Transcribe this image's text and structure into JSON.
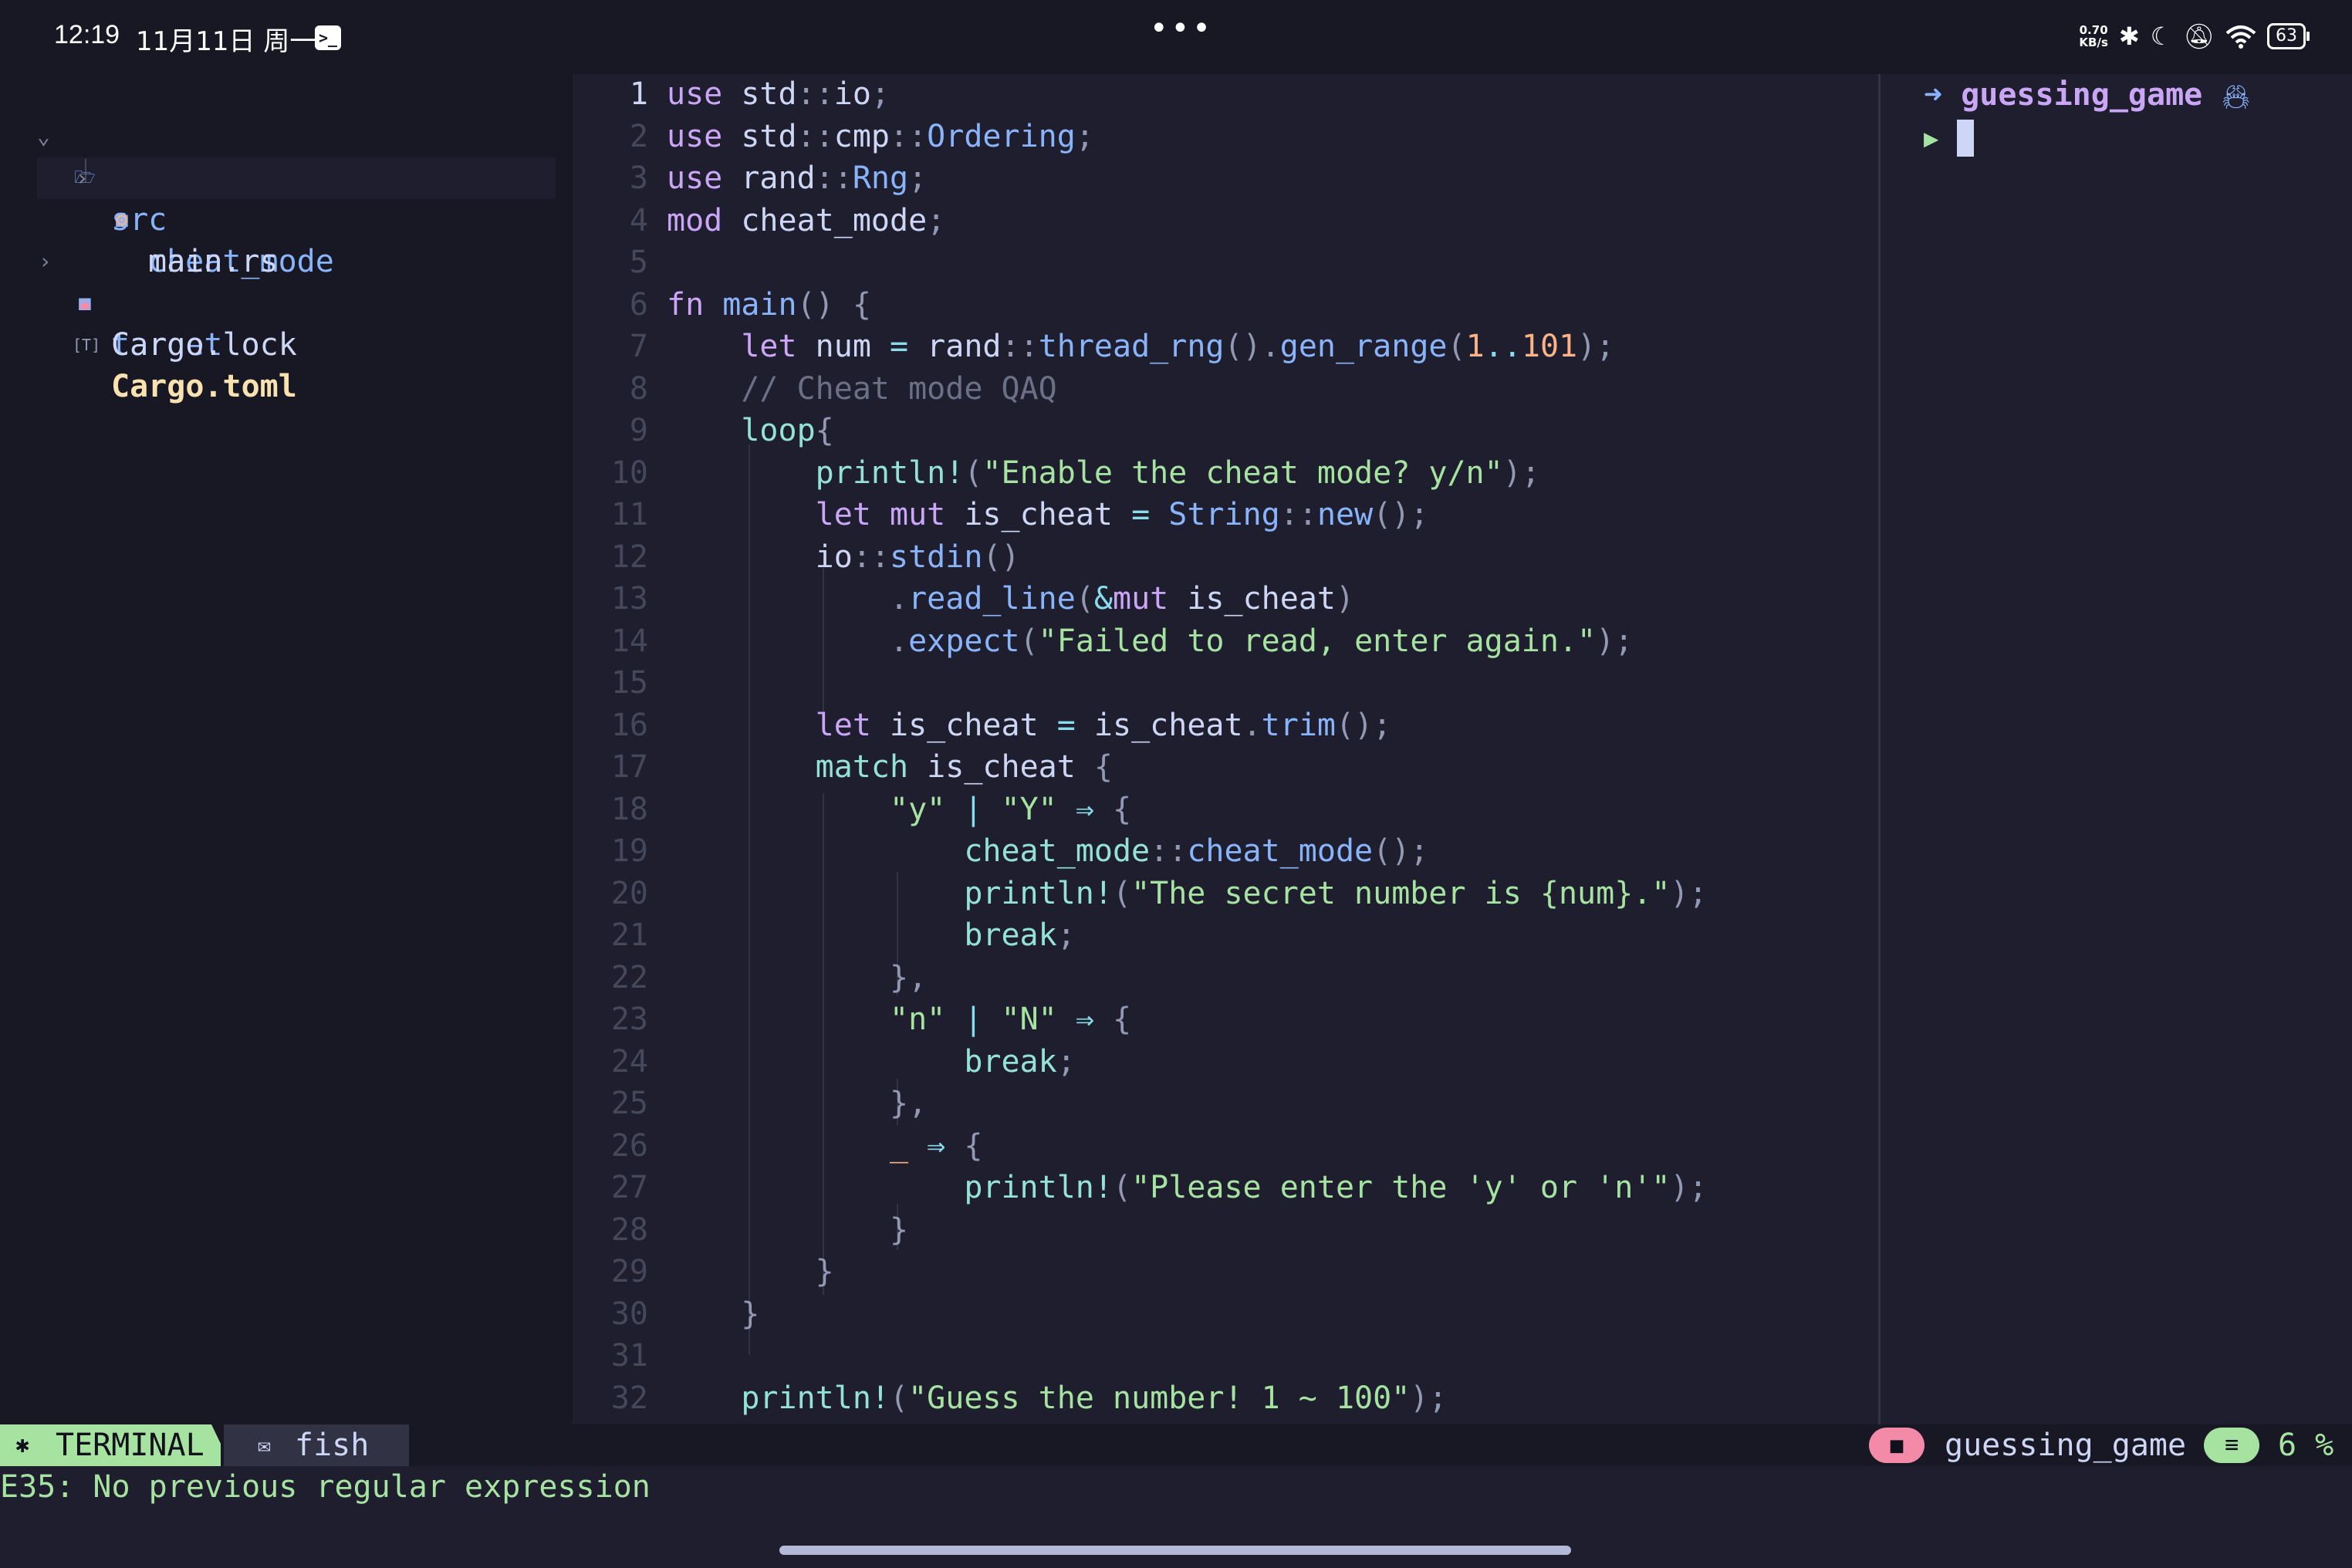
{
  "status_bar": {
    "time": "12:19",
    "date": "11月11日 周一",
    "app_icon": "terminal-icon",
    "menu_dots": "•••",
    "net_speed_value": "0.70",
    "net_speed_unit": "KB/s",
    "battery": "63",
    "icons": [
      "bluetooth-icon",
      "moon-icon",
      "bell-off-icon",
      "wifi-icon",
      "battery-icon"
    ]
  },
  "file_tree": {
    "items": [
      {
        "label": "src",
        "icon": "folder-open-icon",
        "expanded": true
      },
      {
        "label": "cheat_mode",
        "icon": "folder-icon",
        "expanded": false
      },
      {
        "label": "main.rs",
        "icon": "rust-icon",
        "selected": true
      },
      {
        "label": "target",
        "icon": "folder-icon",
        "expanded": false
      },
      {
        "label": "Cargo.lock",
        "icon": "lock-icon"
      },
      {
        "label": "Cargo.toml",
        "icon": "toml-icon",
        "modified": true
      }
    ]
  },
  "editor": {
    "current_line": 1,
    "lines": [
      [
        [
          "k",
          "use"
        ],
        [
          "tx",
          " std"
        ],
        [
          "p",
          "::"
        ],
        [
          "tx",
          "io"
        ],
        [
          "p",
          ";"
        ]
      ],
      [
        [
          "k",
          "use"
        ],
        [
          "tx",
          " std"
        ],
        [
          "p",
          "::"
        ],
        [
          "tx",
          "cmp"
        ],
        [
          "p",
          "::"
        ],
        [
          "f",
          "Ordering"
        ],
        [
          "p",
          ";"
        ]
      ],
      [
        [
          "k",
          "use"
        ],
        [
          "tx",
          " rand"
        ],
        [
          "p",
          "::"
        ],
        [
          "f",
          "Rng"
        ],
        [
          "p",
          ";"
        ]
      ],
      [
        [
          "k",
          "mod"
        ],
        [
          "tx",
          " cheat_mode"
        ],
        [
          "p",
          ";"
        ]
      ],
      [],
      [
        [
          "k",
          "fn"
        ],
        [
          "tx",
          " "
        ],
        [
          "f",
          "main"
        ],
        [
          "p",
          "() {"
        ]
      ],
      [
        [
          "tx",
          "    "
        ],
        [
          "k",
          "let"
        ],
        [
          "tx",
          " num "
        ],
        [
          "o",
          "="
        ],
        [
          "tx",
          " rand"
        ],
        [
          "p",
          "::"
        ],
        [
          "f",
          "thread_rng"
        ],
        [
          "p",
          "()."
        ],
        [
          "f",
          "gen_range"
        ],
        [
          "p",
          "("
        ],
        [
          "n",
          "1"
        ],
        [
          "o",
          ".."
        ],
        [
          "n",
          "101"
        ],
        [
          "p",
          ");"
        ]
      ],
      [
        [
          "c",
          "    // Cheat mode QAQ"
        ]
      ],
      [
        [
          "tx",
          "    "
        ],
        [
          "m",
          "loop"
        ],
        [
          "p",
          "{"
        ]
      ],
      [
        [
          "tx",
          "        "
        ],
        [
          "m",
          "println!"
        ],
        [
          "p",
          "("
        ],
        [
          "s",
          "\"Enable the cheat mode? y/n\""
        ],
        [
          "p",
          ");"
        ]
      ],
      [
        [
          "tx",
          "        "
        ],
        [
          "k",
          "let"
        ],
        [
          "tx",
          " "
        ],
        [
          "k",
          "mut"
        ],
        [
          "tx",
          " is_cheat "
        ],
        [
          "o",
          "="
        ],
        [
          "tx",
          " "
        ],
        [
          "f",
          "String"
        ],
        [
          "p",
          "::"
        ],
        [
          "f",
          "new"
        ],
        [
          "p",
          "();"
        ]
      ],
      [
        [
          "tx",
          "        io"
        ],
        [
          "p",
          "::"
        ],
        [
          "f",
          "stdin"
        ],
        [
          "p",
          "()"
        ]
      ],
      [
        [
          "tx",
          "            "
        ],
        [
          "p",
          "."
        ],
        [
          "f",
          "read_line"
        ],
        [
          "p",
          "("
        ],
        [
          "o",
          "&"
        ],
        [
          "k",
          "mut"
        ],
        [
          "tx",
          " is_cheat"
        ],
        [
          "p",
          ")"
        ]
      ],
      [
        [
          "tx",
          "            "
        ],
        [
          "p",
          "."
        ],
        [
          "f",
          "expect"
        ],
        [
          "p",
          "("
        ],
        [
          "s",
          "\"Failed to read, enter again.\""
        ],
        [
          "p",
          ");"
        ]
      ],
      [],
      [
        [
          "tx",
          "        "
        ],
        [
          "k",
          "let"
        ],
        [
          "tx",
          " is_cheat "
        ],
        [
          "o",
          "="
        ],
        [
          "tx",
          " is_cheat"
        ],
        [
          "p",
          "."
        ],
        [
          "f",
          "trim"
        ],
        [
          "p",
          "();"
        ]
      ],
      [
        [
          "tx",
          "        "
        ],
        [
          "m",
          "match"
        ],
        [
          "tx",
          " is_cheat "
        ],
        [
          "p",
          "{"
        ]
      ],
      [
        [
          "tx",
          "            "
        ],
        [
          "s",
          "\"y\""
        ],
        [
          "tx",
          " "
        ],
        [
          "o",
          "|"
        ],
        [
          "tx",
          " "
        ],
        [
          "s",
          "\"Y\""
        ],
        [
          "tx",
          " "
        ],
        [
          "o",
          "⇒"
        ],
        [
          "tx",
          " "
        ],
        [
          "p",
          "{"
        ]
      ],
      [
        [
          "tx",
          "                "
        ],
        [
          "m",
          "cheat_mode"
        ],
        [
          "p",
          "::"
        ],
        [
          "f",
          "cheat_mode"
        ],
        [
          "p",
          "();"
        ]
      ],
      [
        [
          "tx",
          "                "
        ],
        [
          "m",
          "println!"
        ],
        [
          "p",
          "("
        ],
        [
          "s",
          "\"The secret number is {num}.\""
        ],
        [
          "p",
          ");"
        ]
      ],
      [
        [
          "tx",
          "                "
        ],
        [
          "m",
          "break"
        ],
        [
          "p",
          ";"
        ]
      ],
      [
        [
          "tx",
          "            "
        ],
        [
          "p",
          "},"
        ]
      ],
      [
        [
          "tx",
          "            "
        ],
        [
          "s",
          "\"n\""
        ],
        [
          "tx",
          " "
        ],
        [
          "o",
          "|"
        ],
        [
          "tx",
          " "
        ],
        [
          "s",
          "\"N\""
        ],
        [
          "tx",
          " "
        ],
        [
          "o",
          "⇒"
        ],
        [
          "tx",
          " "
        ],
        [
          "p",
          "{"
        ]
      ],
      [
        [
          "tx",
          "                "
        ],
        [
          "m",
          "break"
        ],
        [
          "p",
          ";"
        ]
      ],
      [
        [
          "tx",
          "            "
        ],
        [
          "p",
          "},"
        ]
      ],
      [
        [
          "tx",
          "            "
        ],
        [
          "n",
          "_"
        ],
        [
          "tx",
          " "
        ],
        [
          "o",
          "⇒"
        ],
        [
          "tx",
          " "
        ],
        [
          "p",
          "{"
        ]
      ],
      [
        [
          "tx",
          "                "
        ],
        [
          "m",
          "println!"
        ],
        [
          "p",
          "("
        ],
        [
          "s",
          "\"Please enter the 'y' or 'n'\""
        ],
        [
          "p",
          ");"
        ]
      ],
      [
        [
          "tx",
          "            "
        ],
        [
          "p",
          "}"
        ]
      ],
      [
        [
          "tx",
          "        "
        ],
        [
          "p",
          "}"
        ]
      ],
      [
        [
          "tx",
          "    "
        ],
        [
          "p",
          "}"
        ]
      ],
      [],
      [
        [
          "tx",
          "    "
        ],
        [
          "m",
          "println!"
        ],
        [
          "p",
          "("
        ],
        [
          "s",
          "\"Guess the number! 1 ~ 100\""
        ],
        [
          "p",
          ");"
        ]
      ],
      []
    ]
  },
  "terminal_panel": {
    "prompt_arrow": "➜",
    "cwd": "guessing_game",
    "cwd_icon": "rust-crab-icon",
    "prompt_symbol": "▶"
  },
  "bottom_bar": {
    "terminal_tab_icon": "terminal-icon",
    "terminal_tab_label": "TERMINAL",
    "shell_icon": "shell-icon",
    "shell_label": "fish",
    "project_icon": "folder-icon",
    "project_name": "guessing_game",
    "lines_icon": "lines-icon",
    "progress_percent": "6 %"
  },
  "command_line": {
    "message": "E35: No previous regular expression"
  }
}
